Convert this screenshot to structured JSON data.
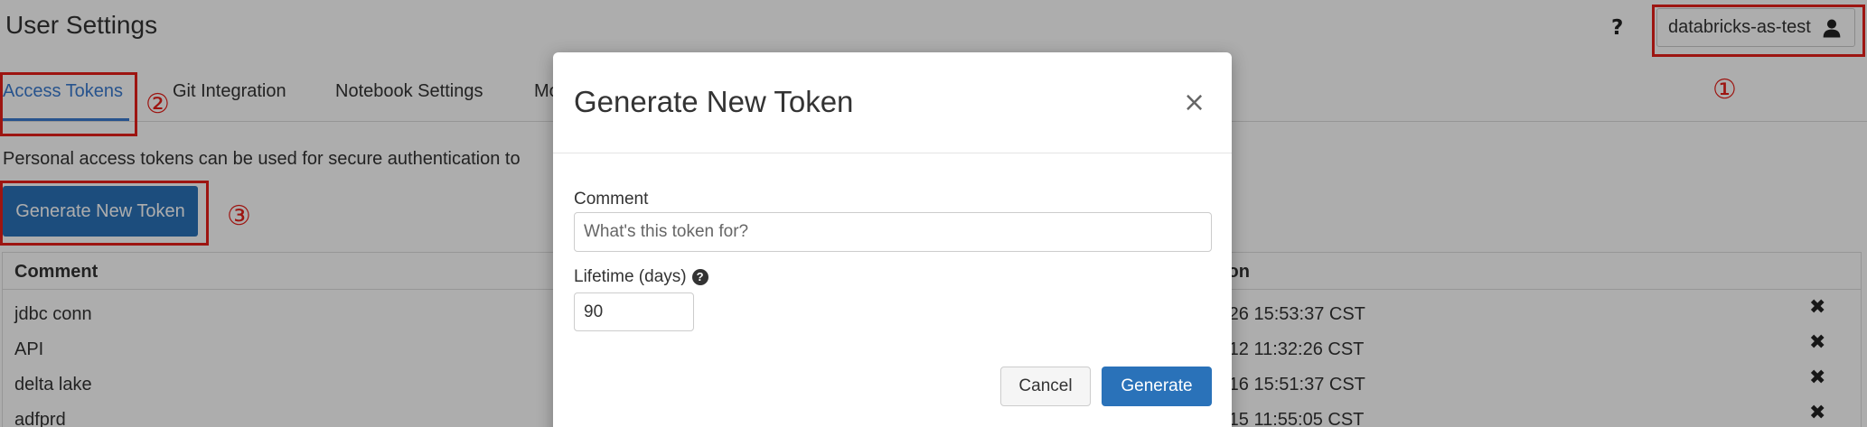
{
  "page": {
    "title": "User Settings",
    "help_icon": "question-icon",
    "user_button_label": "databricks-as-test",
    "user_icon": "user-icon"
  },
  "tabs": [
    {
      "label": "Access Tokens",
      "active": true
    },
    {
      "label": "Git Integration",
      "active": false
    },
    {
      "label": "Notebook Settings",
      "active": false
    },
    {
      "label": "Mo",
      "active": false
    }
  ],
  "tokens": {
    "description": "Personal access tokens can be used for secure authentication to",
    "generate_button_label": "Generate New Token",
    "columns": [
      "Comment",
      "ion"
    ],
    "rows": [
      {
        "comment": "jdbc  conn",
        "expiration": "-26 15:53:37 CST"
      },
      {
        "comment": "API",
        "expiration": "-12 11:32:26 CST"
      },
      {
        "comment": "delta lake",
        "expiration": "-16 15:51:37 CST"
      },
      {
        "comment": "adfprd",
        "expiration": "-15 11:55:05 CST"
      }
    ],
    "delete_icon": "close-icon"
  },
  "annotations": [
    "①",
    "②",
    "③"
  ],
  "annotation_color": "#e8201a",
  "modal": {
    "title": "Generate New Token",
    "close_symbol": "×",
    "comment_label": "Comment",
    "comment_placeholder": "What's this token for?",
    "comment_value": "",
    "lifetime_label": "Lifetime (days)",
    "lifetime_help_symbol": "?",
    "lifetime_value": "90",
    "cancel_label": "Cancel",
    "generate_label": "Generate"
  },
  "colors": {
    "accent": "#2a72b9",
    "active_tab": "#3a7bd0"
  }
}
